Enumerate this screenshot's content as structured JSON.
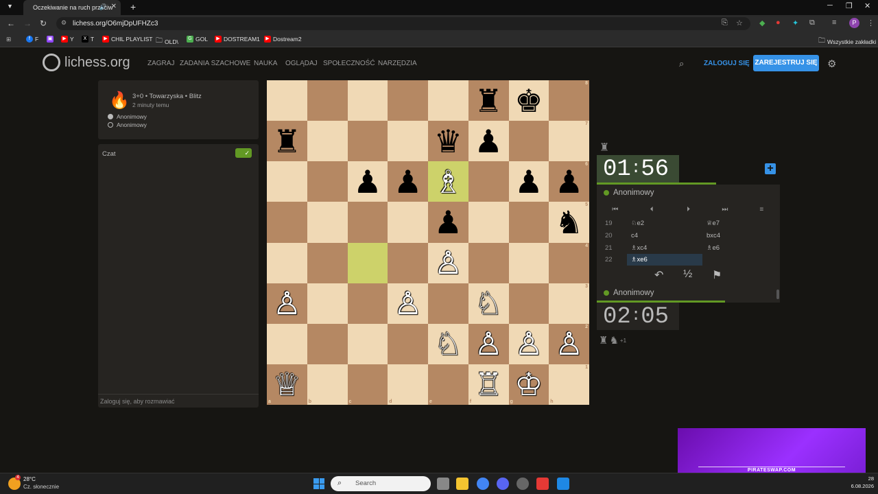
{
  "browser": {
    "tab_title": "Oczekiwanie na ruch przeciw",
    "url": "lichess.org/O6mjDpUFHZc3",
    "bookmarks": [
      {
        "label": "F",
        "color": "#1877f2"
      },
      {
        "label": "",
        "color": "#9146ff"
      },
      {
        "label": "Y",
        "color": "#ff0000"
      },
      {
        "label": "T",
        "color": "#000000"
      },
      {
        "label": "CHIL PLAYLIST",
        "color": "#ff0000"
      },
      {
        "label": "OLD\\",
        "color": ""
      },
      {
        "label": "GOL",
        "color": "#4caf50"
      },
      {
        "label": "DOSTREAM1",
        "color": "#ff0000"
      },
      {
        "label": "Dostream2",
        "color": "#ff0000"
      }
    ],
    "all_bookmarks": "Wszystkie zakładki",
    "profile_initial": "P"
  },
  "site": {
    "logo": "lichess.org",
    "nav": [
      "ZAGRAJ",
      "ZADANIA SZACHOWE",
      "NAUKA",
      "OGLĄDAJ",
      "SPOŁECZNOŚĆ",
      "NARZĘDZIA"
    ],
    "login": "ZALOGUJ SIĘ",
    "signup": "ZAREJESTRUJ SIĘ"
  },
  "game": {
    "title": "3+0 • Towarzyska • Blitz",
    "time_ago": "2 minuty temu",
    "white_player": "Anonimowy",
    "black_player": "Anonimowy"
  },
  "chat": {
    "title": "Czat",
    "placeholder": "Zaloguj się, aby rozmawiać"
  },
  "board": {
    "highlight": [
      "e6",
      "c4"
    ],
    "files": [
      "a",
      "b",
      "c",
      "d",
      "e",
      "f",
      "g",
      "h"
    ],
    "ranks": [
      "8",
      "7",
      "6",
      "5",
      "4",
      "3",
      "2",
      "1"
    ],
    "pieces": {
      "f8": "♜b",
      "g8": "♚b",
      "a7": "♜b",
      "e7": "♛b",
      "f7": "♟b",
      "c6": "♟b",
      "d6": "♟b",
      "e6": "♗w",
      "g6": "♟b",
      "h6": "♟b",
      "e5": "♟b",
      "h5": "♞b",
      "e4": "♙w",
      "a3": "♙w",
      "d3": "♙w",
      "f3": "♘w",
      "e2": "♘w",
      "f2": "♙w",
      "g2": "♙w",
      "h2": "♙w",
      "a1": "♕w",
      "f1": "♖w",
      "g1": "♔w"
    }
  },
  "clocks": {
    "top_min": "01",
    "top_sec": "56",
    "bottom_min": "02",
    "bottom_sec": "05",
    "top_bar_fraction": 0.65,
    "bottom_bar_fraction": 0.7
  },
  "players": {
    "top": "Anonimowy",
    "bottom": "Anonimowy"
  },
  "moves": [
    {
      "n": "19",
      "w": "♘e2",
      "b": "♕e7"
    },
    {
      "n": "20",
      "w": "c4",
      "b": "bxc4"
    },
    {
      "n": "21",
      "w": "♗xc4",
      "b": "♗e6"
    },
    {
      "n": "22",
      "w": "♗xe6",
      "b": ""
    }
  ],
  "material": {
    "icons": [
      "rook-icon",
      "knight-icon"
    ],
    "diff": "+1"
  },
  "overlay": {
    "text": "PIRATESWAP.COM"
  },
  "taskbar": {
    "temp": "28°C",
    "weather": "Cz. słonecznie",
    "weather_badge": "4",
    "search": "Search",
    "time": "28",
    "date": "6.08.2026"
  },
  "colors": {
    "accent": "#3692e7",
    "green": "#629924",
    "board_light": "#f0d9b5",
    "board_dark": "#b58863"
  }
}
